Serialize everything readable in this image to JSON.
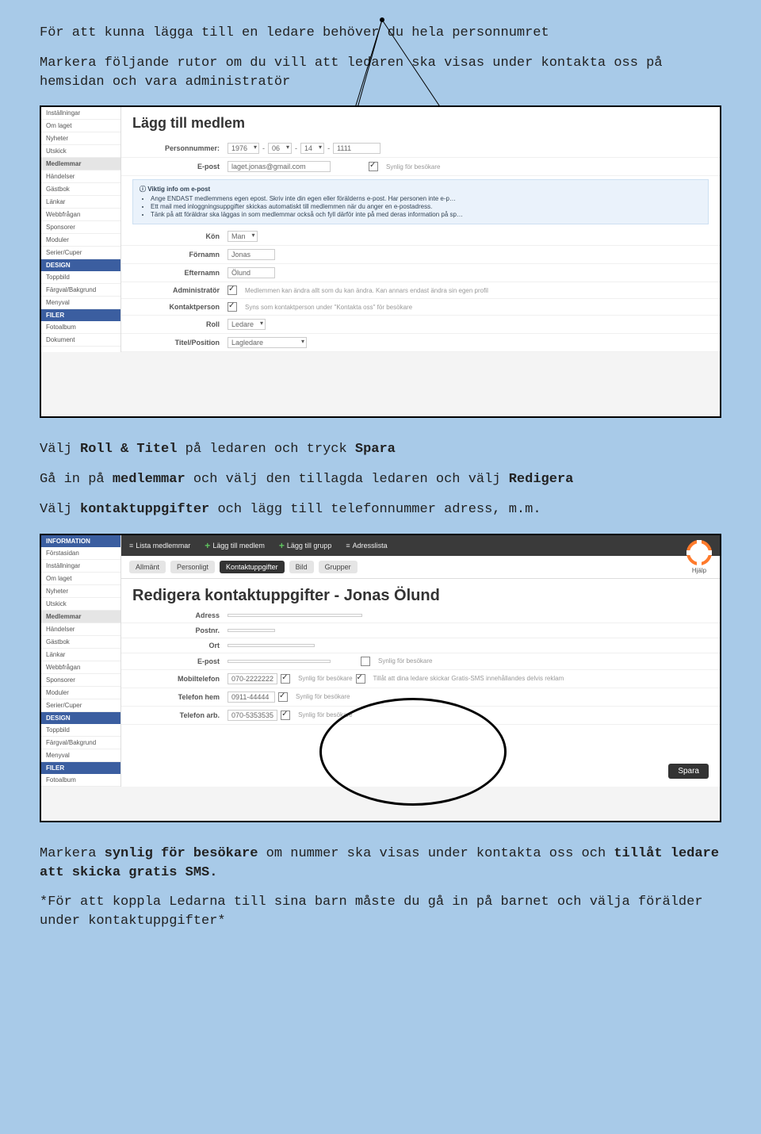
{
  "intro": {
    "p1a": "För att kunna lägga till en ledare behöver du hela personnumret",
    "p2a": "Markera följande rutor om du vill att ledaren ska visas under kontakta oss på hemsidan och vara administratör"
  },
  "shot1": {
    "sidebar": {
      "items": [
        "Inställningar",
        "Om laget",
        "Nyheter",
        "Utskick",
        "Medlemmar",
        "Händelser",
        "Gästbok",
        "Länkar",
        "Webbfrågan",
        "Sponsorer",
        "Moduler",
        "Serier/Cuper"
      ],
      "design_head": "DESIGN",
      "design_items": [
        "Toppbild",
        "Färgval/Bakgrund",
        "Menyval"
      ],
      "filer_head": "FILER",
      "filer_items": [
        "Fotoalbum",
        "Dokument"
      ]
    },
    "title": "Lägg till medlem",
    "labels": {
      "personnummer": "Personnummer:",
      "epost": "E-post",
      "kon": "Kön",
      "fornamn": "Förnamn",
      "efternamn": "Efternamn",
      "admin": "Administratör",
      "kontakt": "Kontaktperson",
      "roll": "Roll",
      "titel": "Titel/Position"
    },
    "values": {
      "pn_year": "1976",
      "pn_mon": "06",
      "pn_day": "14",
      "pn_last": "1111",
      "epost": "laget.jonas@gmail.com",
      "synlig": "Synlig för besökare",
      "kon": "Man",
      "fornamn": "Jonas",
      "efternamn": "Ölund",
      "admin_hint": "Medlemmen kan ändra allt som du kan ändra. Kan annars endast ändra sin egen profil",
      "kontakt_hint": "Syns som kontaktperson under \"Kontakta oss\" för besökare",
      "roll": "Ledare",
      "titel": "Lagledare"
    },
    "info": {
      "title": "Viktig info om e-post",
      "b1": "Ange ENDAST medlemmens egen epost. Skriv inte din egen eller förälderns e-post. Har personen inte e-p…",
      "b2": "Ett mail med inloggningsuppgifter skickas automatiskt till medlemmen när du anger en e-postadress.",
      "b3": "Tänk på att föräldrar ska läggas in som medlemmar också och fyll därför inte på med deras information på sp…"
    }
  },
  "mid": {
    "p1_pre": "Välj ",
    "p1_b1": "Roll & Titel",
    "p1_mid": " på ledaren och tryck ",
    "p1_b2": "Spara",
    "p2_pre": "Gå in på ",
    "p2_b1": "medlemmar",
    "p2_mid": " och välj den tillagda ledaren och välj ",
    "p2_b2": "Redigera",
    "p3_pre": "Välj ",
    "p3_b1": "kontaktuppgifter",
    "p3_post": " och lägg till telefonnummer adress, m.m."
  },
  "shot2": {
    "sidebar": {
      "info_head": "INFORMATION",
      "items": [
        "Förstasidan",
        "Inställningar",
        "Om laget",
        "Nyheter",
        "Utskick",
        "Medlemmar",
        "Händelser",
        "Gästbok",
        "Länkar",
        "Webbfrågan",
        "Sponsorer",
        "Moduler",
        "Serier/Cuper"
      ],
      "design_head": "DESIGN",
      "design_items": [
        "Toppbild",
        "Färgval/Bakgrund",
        "Menyval"
      ],
      "filer_head": "FILER",
      "filer_items": [
        "Fotoalbum"
      ]
    },
    "toolbar": {
      "lista": "Lista medlemmar",
      "lagg_medlem": "Lägg till medlem",
      "lagg_grupp": "Lägg till grupp",
      "adress": "Adresslista"
    },
    "tabs": [
      "Allmänt",
      "Personligt",
      "Kontaktuppgifter",
      "Bild",
      "Grupper"
    ],
    "help": "Hjälp",
    "title": "Redigera kontaktuppgifter - Jonas Ölund",
    "labels": {
      "adress": "Adress",
      "postnr": "Postnr.",
      "ort": "Ort",
      "epost": "E-post",
      "mobil": "Mobiltelefon",
      "telhem": "Telefon hem",
      "telarb": "Telefon arb."
    },
    "values": {
      "mobil": "070-2222222",
      "telhem": "0911-44444",
      "telarb": "070-5353535",
      "synlig": "Synlig för besökare",
      "tillat": "Tillåt att dina ledare skickar Gratis-SMS innehållandes delvis reklam"
    },
    "save": "Spara"
  },
  "outro": {
    "p1_pre": "Markera ",
    "p1_b1": "synlig för besökare",
    "p1_mid": " om nummer ska visas under kontakta oss och ",
    "p1_b2": "tillåt ledare att skicka gratis SMS.",
    "p2": "*För att koppla Ledarna till sina barn måste du gå in på barnet och välja förälder under kontaktuppgifter*"
  }
}
